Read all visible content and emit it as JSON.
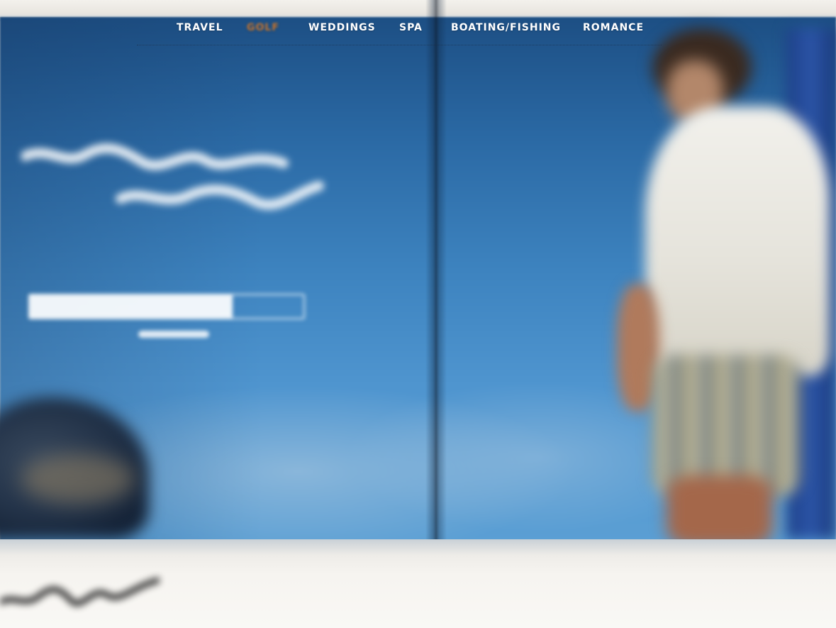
{
  "nav": {
    "items": [
      {
        "label": "TRAVEL",
        "active": false
      },
      {
        "label": "GOLF",
        "active": true
      },
      {
        "label": "WEDDINGS",
        "active": false
      },
      {
        "label": "SPA",
        "active": false
      },
      {
        "label": "BOATING/FISHING",
        "active": false
      },
      {
        "label": "ROMANCE",
        "active": false
      }
    ],
    "active_color": "#c8762f",
    "text_color": "#ffffff"
  },
  "loader": {
    "progress": 0.74
  },
  "colors": {
    "sky_top": "#1d4f84",
    "sky_bottom": "#5b9fd4",
    "page_white": "#f6f4f0"
  }
}
